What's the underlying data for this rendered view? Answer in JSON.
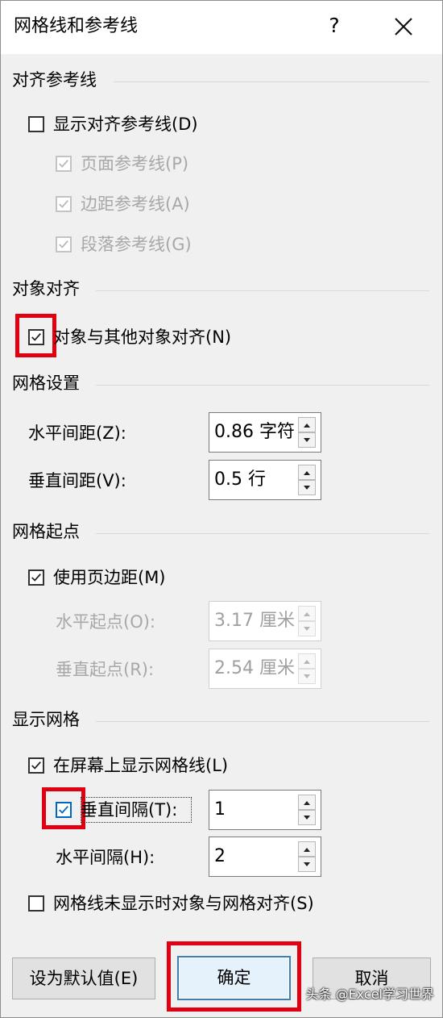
{
  "window": {
    "title": "网格线和参考线",
    "help_label": "?"
  },
  "alignment_guides": {
    "section_title": "对齐参考线",
    "show_alignment_guides": {
      "label": "显示对齐参考线(D)",
      "checked": false
    },
    "page_guides": {
      "label": "页面参考线(P)",
      "checked": true,
      "enabled": false
    },
    "margin_guides": {
      "label": "边距参考线(A)",
      "checked": true,
      "enabled": false
    },
    "paragraph_guides": {
      "label": "段落参考线(G)",
      "checked": true,
      "enabled": false
    }
  },
  "object_alignment": {
    "section_title": "对象对齐",
    "align_to_other_objects": {
      "label": "对象与其他对象对齐(N)",
      "checked": true
    }
  },
  "grid_settings": {
    "section_title": "网格设置",
    "horizontal_spacing": {
      "label": "水平间距(Z):",
      "value": "0.86 字符"
    },
    "vertical_spacing": {
      "label": "垂直间距(V):",
      "value": "0.5 行"
    }
  },
  "grid_origin": {
    "section_title": "网格起点",
    "use_margins": {
      "label": "使用页边距(M)",
      "checked": true
    },
    "horizontal_origin": {
      "label": "水平起点(O):",
      "value": "3.17 厘米",
      "enabled": false
    },
    "vertical_origin": {
      "label": "垂直起点(R):",
      "value": "2.54 厘米",
      "enabled": false
    }
  },
  "show_grid": {
    "section_title": "显示网格",
    "display_gridlines": {
      "label": "在屏幕上显示网格线(L)",
      "checked": true
    },
    "vertical_every": {
      "label": "垂直间隔(T):",
      "checked": true,
      "value": "1"
    },
    "horizontal_every": {
      "label": "水平间隔(H):",
      "value": "2"
    },
    "snap_when_hidden": {
      "label": "网格线未显示时对象与网格对齐(S)",
      "checked": false
    }
  },
  "buttons": {
    "set_default": "设为默认值(E)",
    "ok": "确定",
    "cancel": "取消"
  },
  "watermark": "头条 @Excel学习世界",
  "colors": {
    "highlight": "#e10012",
    "primary_border": "#3c7fb1",
    "checkbox_blue": "#0067c0"
  },
  "icons": {
    "close": "close-icon",
    "help": "question-mark-icon",
    "check": "checkmark-icon",
    "up": "up-arrow-icon",
    "down": "down-arrow-icon"
  }
}
